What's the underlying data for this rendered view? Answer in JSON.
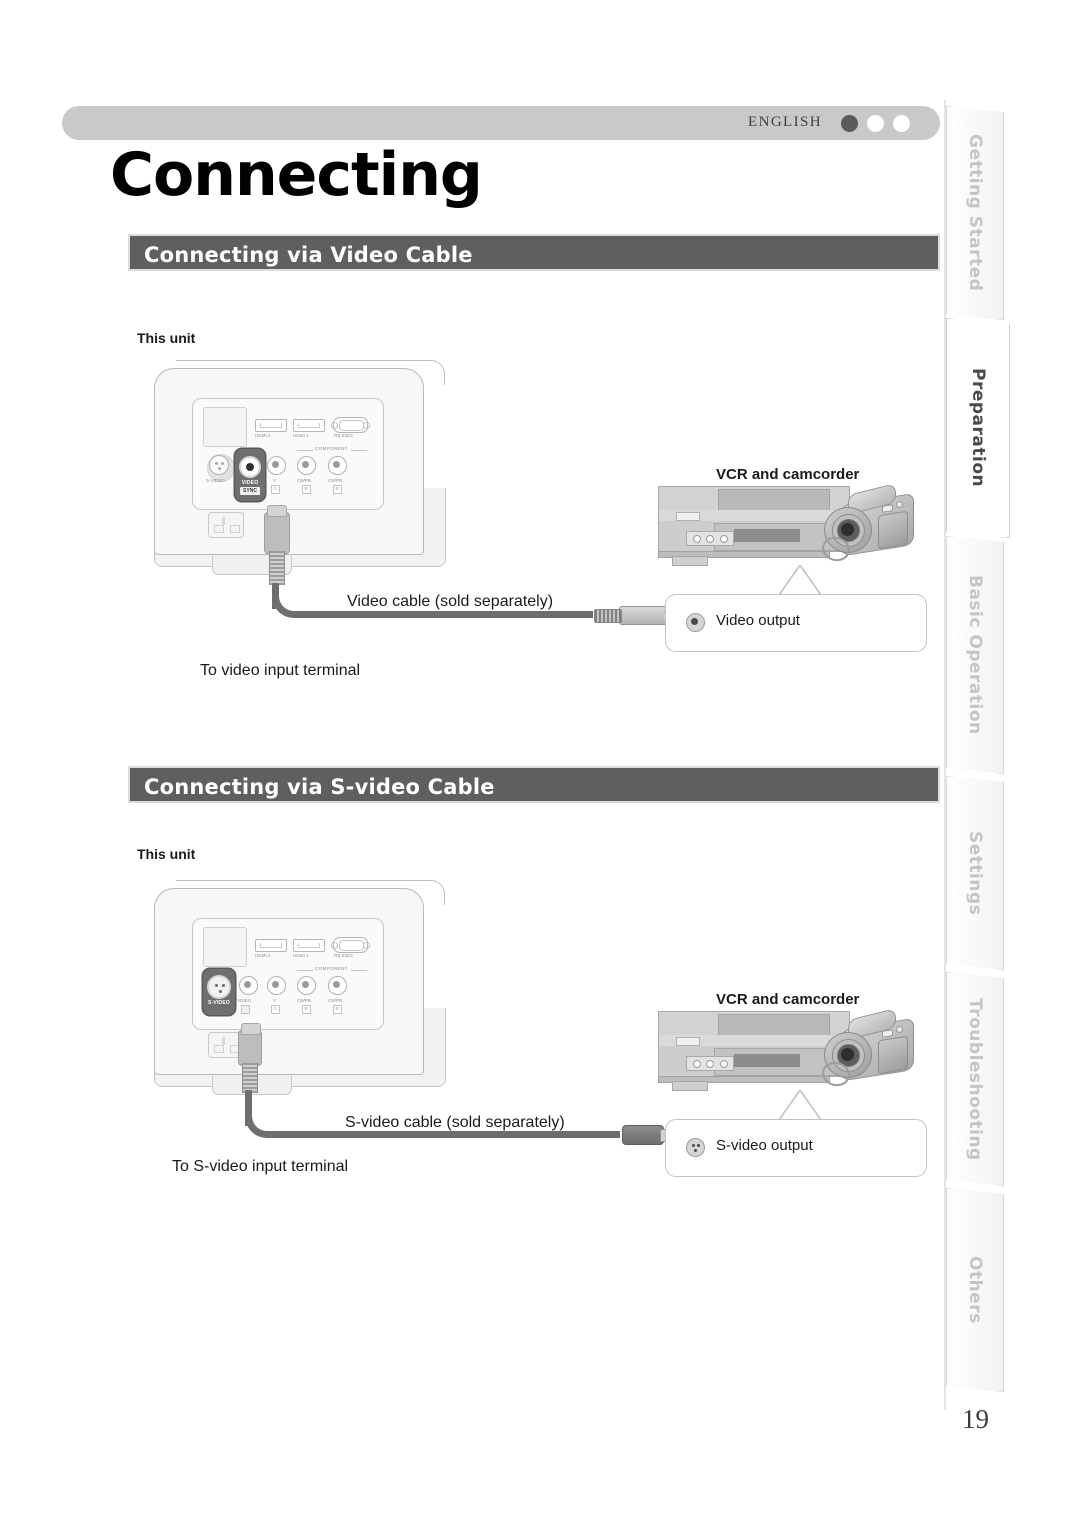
{
  "header": {
    "language": "ENGLISH",
    "dots": [
      "filled",
      "hollow",
      "hollow"
    ]
  },
  "page_title": "Connecting",
  "page_number": "19",
  "sections": [
    {
      "title": "Connecting via Video Cable",
      "unit_label": "This unit",
      "device_label": "VCR and camcorder",
      "cable_label": "Video cable (sold separately)",
      "terminal_label": "To video input terminal",
      "output_label": "Video output",
      "highlighted_port": "VIDEO / SYNC"
    },
    {
      "title": "Connecting via S-video Cable",
      "unit_label": "This unit",
      "device_label": "VCR and camcorder",
      "cable_label": "S-video cable (sold separately)",
      "terminal_label": "To S-video input terminal",
      "output_label": "S-video output",
      "highlighted_port": "S-VIDEO"
    }
  ],
  "terminal_panel": {
    "top_row": [
      "HDMI 2",
      "HDMI 1",
      "RS-232C"
    ],
    "bottom_row": [
      "S-VIDEO",
      "VIDEO",
      "Y",
      "CB/PB",
      "CR/PR"
    ],
    "group_label": "COMPONENT",
    "sync_badge": "SYNC",
    "component_boxes": [
      "G",
      "B",
      "R"
    ]
  },
  "side_tabs": [
    {
      "label": "Getting Started",
      "active": false
    },
    {
      "label": "Preparation",
      "active": true
    },
    {
      "label": "Basic Operation",
      "active": false
    },
    {
      "label": "Settings",
      "active": false
    },
    {
      "label": "Troubleshooting",
      "active": false
    },
    {
      "label": "Others",
      "active": false
    }
  ]
}
